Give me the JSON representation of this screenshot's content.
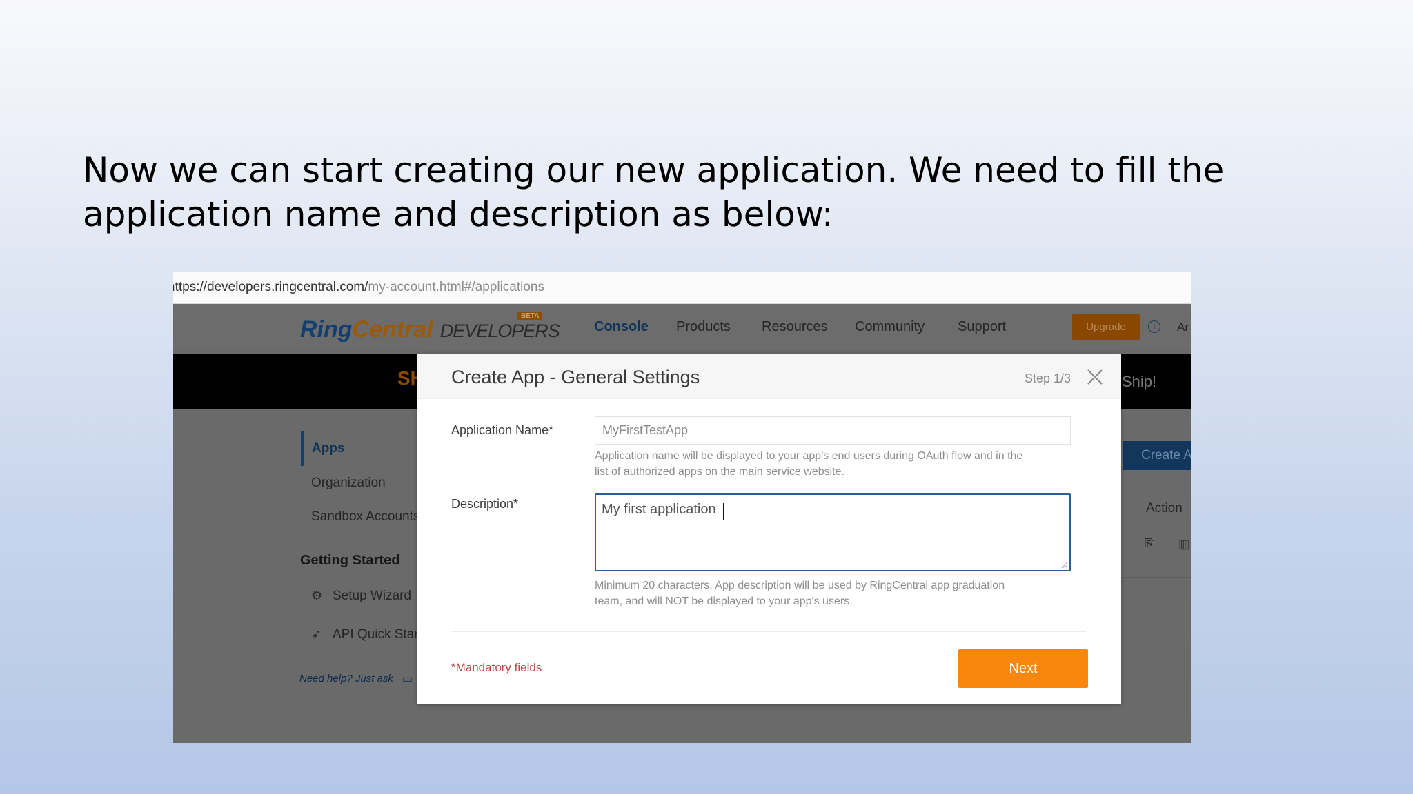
{
  "slide": {
    "line1": "Now we can start creating our new application. We need to fill the",
    "line2": "application name and description as below:"
  },
  "browser": {
    "url_host": "https://developers.ringcentral.com/",
    "url_path": "my-account.html#/applications"
  },
  "header": {
    "logo_ring": "Ring",
    "logo_central": "Central",
    "logo_developers": "DEVELOPERS",
    "beta_badge": "BETA",
    "nav": [
      "Console",
      "Products",
      "Resources",
      "Community",
      "Support"
    ],
    "upgrade_label": "Upgrade",
    "user_label": "Ar"
  },
  "banner": {
    "left_text": "SH",
    "right_text": "Ship!"
  },
  "sidebar": {
    "items": [
      "Apps",
      "Organization",
      "Sandbox Accounts"
    ],
    "section_title": "Getting Started",
    "guides": [
      "Setup Wizard",
      "API Quick Start"
    ],
    "help_text": "Need help? Just ask"
  },
  "apps_table": {
    "create_label": "Create App",
    "action_header": "Action"
  },
  "modal": {
    "title": "Create App - General Settings",
    "step": "Step 1/3",
    "app_name_label": "Application Name*",
    "app_name_value": "MyFirstTestApp",
    "app_name_help_1": "Application name will be displayed to your app's end users during OAuth flow and in the",
    "app_name_help_2": "list of authorized apps on the main service website.",
    "description_label": "Description*",
    "description_value": "My first application",
    "description_help_1": "Minimum 20 characters. App description will be used by RingCentral app graduation",
    "description_help_2": "team, and will NOT be displayed to your app's users.",
    "mandatory_note": "*Mandatory fields",
    "next_label": "Next"
  },
  "colors": {
    "primary_orange": "#f7870f",
    "brand_blue": "#123f6d",
    "focus_border": "#2a5f8f",
    "mandatory_red": "#b04a47"
  }
}
